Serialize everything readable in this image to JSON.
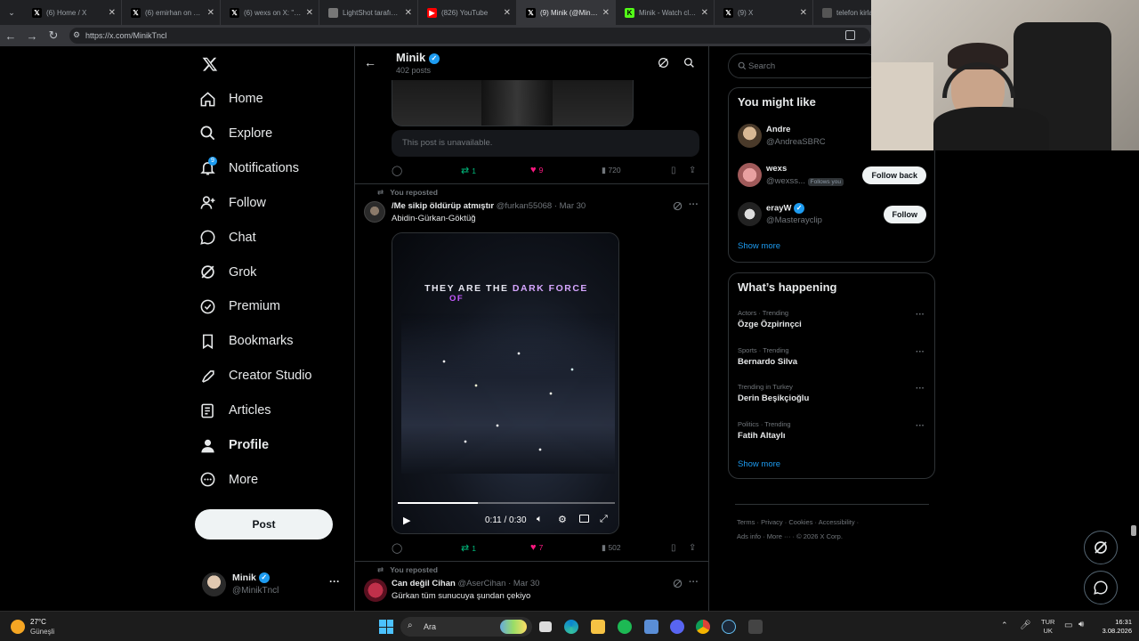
{
  "browser": {
    "tabs": [
      {
        "title": "(6) Home / X",
        "icon": "x-logo",
        "active": false
      },
      {
        "title": "(6) emirhan on X: \"E...",
        "icon": "x-logo",
        "active": false
      },
      {
        "title": "(6) wexs on X: \"eski...",
        "icon": "x-logo",
        "active": false
      },
      {
        "title": "LightShot tarafından...",
        "icon": "feather-icon",
        "active": false
      },
      {
        "title": "(826) YouTube",
        "icon": "youtube-logo",
        "active": false
      },
      {
        "title": "(9) Minik (@MinikTn...",
        "icon": "x-logo",
        "active": true
      },
      {
        "title": "Minik - Watch clips c...",
        "icon": "kick-logo",
        "active": false
      },
      {
        "title": "(9) X",
        "icon": "x-logo",
        "active": false
      },
      {
        "title": "telefon kirla...",
        "icon": "generic-icon",
        "active": false
      }
    ],
    "url": "https://x.com/MinikTncl"
  },
  "nav": {
    "items": [
      {
        "label": "Home",
        "icon": "home-icon"
      },
      {
        "label": "Explore",
        "icon": "search-icon"
      },
      {
        "label": "Notifications",
        "icon": "bell-icon",
        "badge": "9"
      },
      {
        "label": "Follow",
        "icon": "person-add-icon"
      },
      {
        "label": "Chat",
        "icon": "chat-icon"
      },
      {
        "label": "Grok",
        "icon": "grok-icon"
      },
      {
        "label": "Premium",
        "icon": "premium-icon"
      },
      {
        "label": "Bookmarks",
        "icon": "bookmark-icon"
      },
      {
        "label": "Creator Studio",
        "icon": "rocket-icon"
      },
      {
        "label": "Articles",
        "icon": "article-icon"
      },
      {
        "label": "Profile",
        "icon": "profile-icon"
      },
      {
        "label": "More",
        "icon": "more-circle-icon"
      }
    ],
    "post_label": "Post",
    "account": {
      "name": "Minik",
      "handle": "@MinikTncl"
    }
  },
  "profile_header": {
    "name": "Minik",
    "post_count": "402 posts"
  },
  "post1": {
    "unavailable_text": "This post is unavailable.",
    "replies": "",
    "reposts": "1",
    "likes": "9",
    "views": "720"
  },
  "post2": {
    "repost_label": "You reposted",
    "author": "/Me sikip öldürüp atmıştır",
    "handle": "@furkan55068",
    "date": "· Mar 30",
    "text": "Abidin-Gürkan-Göktüğ",
    "video": {
      "overlay_line1": "THEY ARE THE",
      "overlay_highlight": "DARK FORCE",
      "overlay_line2": "OF",
      "time": "0:11 / 0:30",
      "progress": 0.367
    },
    "reposts": "1",
    "likes": "7",
    "views": "502"
  },
  "post3": {
    "repost_label": "You reposted",
    "author": "Can değil Cihan",
    "handle": "@AserCihan",
    "date": "· Mar 30",
    "text": "Gürkan tüm sunucuya şundan çekiyo"
  },
  "search": {
    "placeholder": "Search"
  },
  "might_like": {
    "title": "You might like",
    "users": [
      {
        "name": "Andre",
        "handle": "@AndreaSBRC",
        "verified": false,
        "button": ""
      },
      {
        "name": "wexs",
        "handle": "@wexss...",
        "verified": false,
        "follows_you": "Follows you",
        "button": "Follow back"
      },
      {
        "name": "erayW",
        "handle": "@Masterayclip",
        "verified": true,
        "button": "Follow"
      }
    ],
    "show_more": "Show more"
  },
  "happening": {
    "title": "What’s happening",
    "trends": [
      {
        "context": "Actors · Trending",
        "topic": "Özge Özpirinçci"
      },
      {
        "context": "Sports · Trending",
        "topic": "Bernardo Silva"
      },
      {
        "context": "Trending in Turkey",
        "topic": "Derin Beşikçioğlu"
      },
      {
        "context": "Politics · Trending",
        "topic": "Fatih Altaylı"
      }
    ],
    "show_more": "Show more"
  },
  "footer": {
    "links": [
      "Terms",
      "Privacy",
      "Cookies",
      "Accessibility",
      "Ads info",
      "More ···",
      "© 2026 X Corp."
    ]
  },
  "taskbar": {
    "weather_temp": "27°C",
    "weather_desc": "Güneşli",
    "search_label": "Ara",
    "lang_line1": "TUR",
    "lang_line2": "UK",
    "time": "16:31",
    "date": "3.08.2026"
  }
}
